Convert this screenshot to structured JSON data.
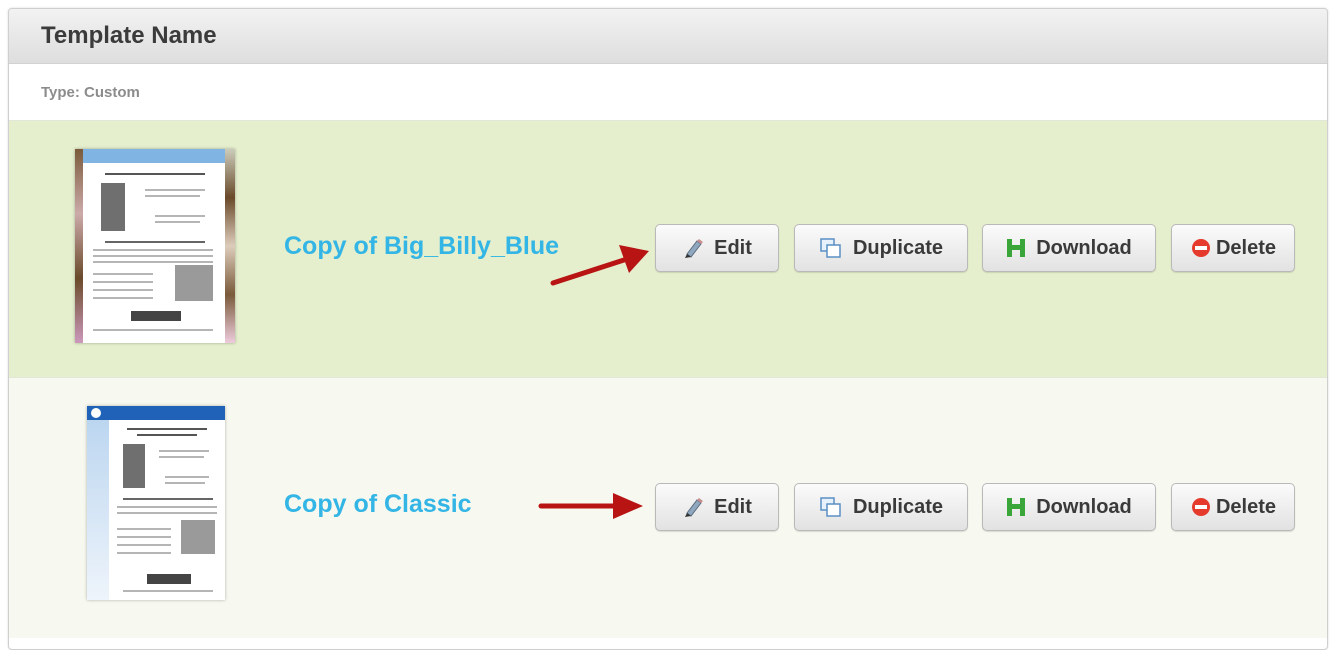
{
  "header": {
    "title": "Template Name"
  },
  "type_label": "Type: Custom",
  "templates": [
    {
      "name": "Copy of Big_Billy_Blue",
      "thumbnail_icon": "template-preview-big-billy-blue",
      "buttons": {
        "edit": "Edit",
        "duplicate": "Duplicate",
        "download": "Download",
        "delete": "Delete"
      }
    },
    {
      "name": "Copy of Classic",
      "thumbnail_icon": "template-preview-classic",
      "buttons": {
        "edit": "Edit",
        "duplicate": "Duplicate",
        "download": "Download",
        "delete": "Delete"
      }
    }
  ],
  "colors": {
    "title_link": "#33b5e5",
    "row_highlight": "#e5eecd",
    "row_alt": "#f7f8ef",
    "annotation_arrow": "#b81414",
    "download_icon": "#3aa63a",
    "delete_icon": "#e53b2c"
  },
  "icons": [
    "pencil-icon",
    "duplicate-icon",
    "download-icon",
    "delete-icon",
    "annotation-arrow"
  ]
}
